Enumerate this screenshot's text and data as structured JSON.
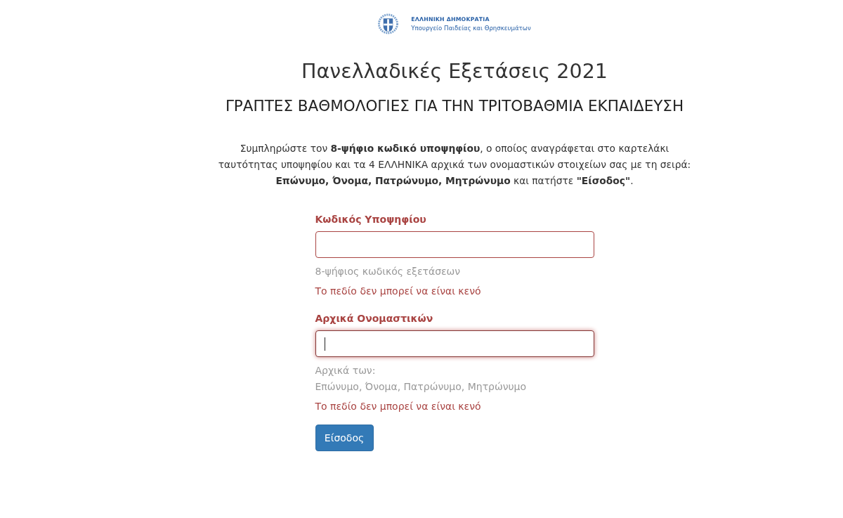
{
  "header": {
    "logo_line_1": "ΕΛΛΗΝΙΚΗ ΔΗΜΟΚΡΑΤΙΑ",
    "logo_line_2": "Υπουργείο Παιδείας και Θρησκευμάτων"
  },
  "title": "Πανελλαδικές Εξετάσεις 2021",
  "subtitle": "ΓΡΑΠΤΕΣ ΒΑΘΜΟΛΟΓΙΕΣ ΓΙΑ ΤΗΝ ΤΡΙΤΟΒΑΘΜΙΑ ΕΚΠΑΙΔΕΥΣΗ",
  "instructions": "Συμπληρώστε τον **8-ψήφιο κωδικό υποψηφίου**, ο οποίος αναγράφεται στο καρτελάκι\nταυτότητας υποψηφίου και τα 4 ΕΛΛΗΝΙΚΑ αρχικά των ονομαστικών στοιχείων σας με τη σειρά:\n**Επώνυμο, Όνομα, Πατρώνυμο, Μητρώνυμο** και πατήστε **\"Είσοδος\"**.",
  "form": {
    "fields": [
      {
        "label": "Κωδικός Υποψηφίου",
        "invalid": true,
        "focused": false,
        "help": [
          "8-ψήφιος κωδικός εξετάσεων"
        ],
        "error": "Το πεδίο δεν μπορεί να είναι κενό"
      },
      {
        "label": "Αρχικά Ονομαστικών",
        "invalid": true,
        "focused": true,
        "help": [
          "Αρχικά των:",
          "Επώνυμο, Όνομα, Πατρώνυμο, Μητρώνυμο"
        ],
        "error": "Το πεδίο δεν μπορεί να είναι κενό"
      }
    ],
    "submit_button": "Είσοδος"
  }
}
